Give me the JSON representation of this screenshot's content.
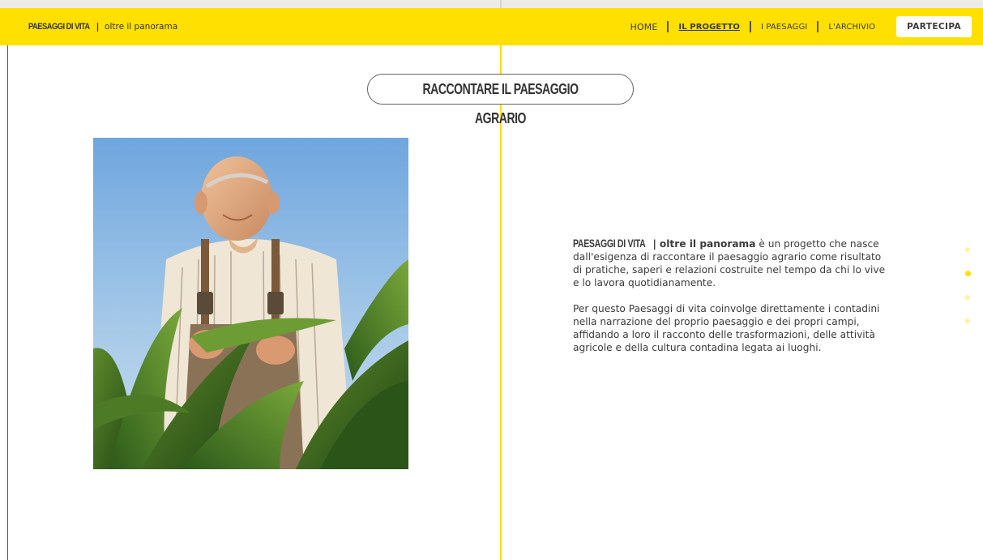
{
  "header": {
    "brand_name": "PAESAGGI DI VITA",
    "brand_separator": "|",
    "brand_tagline": "oltre il panorama",
    "nav": [
      {
        "label": "HOME",
        "active": false
      },
      {
        "label": "IL PROGETTO",
        "active": true
      },
      {
        "label": "I PAESAGGI",
        "active": false
      },
      {
        "label": "L'ARCHIVIO",
        "active": false
      }
    ],
    "cta_label": "PARTECIPA"
  },
  "main": {
    "section_title": "RACCONTARE IL PAESAGGIO AGRARIO",
    "intro": {
      "brand_name": "PAESAGGI DI VITA",
      "separator": "|",
      "tagline": "oltre il panorama",
      "text": " è un progetto che nasce dall'esigenza di raccontare il paesaggio agrario come risultato di pratiche, saperi e relazioni costruite nel tempo da chi lo vive e lo lavora quotidianamente."
    },
    "paragraph2": "Per questo Paesaggi di vita coinvolge direttamente i contadini nella narrazione del proprio paesaggio e dei propri campi, affidando a loro il racconto delle trasformazioni, delle attività agricole e della cultura contadina legata ai luoghi."
  },
  "pagination": {
    "count": 4,
    "active_index": 1
  },
  "colors": {
    "accent": "#ffe000",
    "text": "#333333",
    "dot_inactive": "#fff3a0"
  }
}
